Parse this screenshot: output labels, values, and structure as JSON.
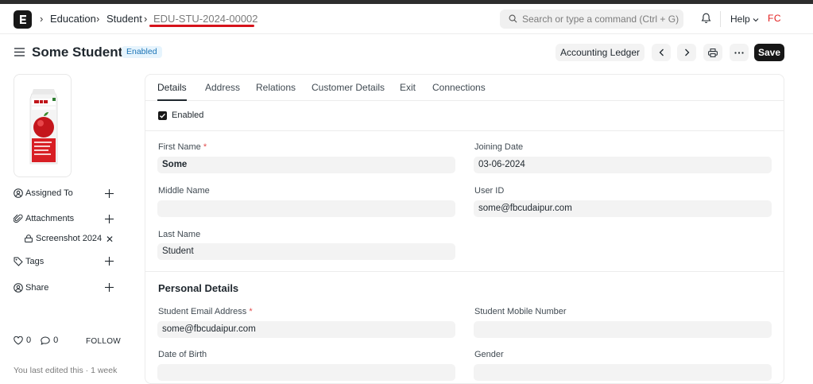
{
  "navbar": {
    "breadcrumbs": [
      "Education",
      "Student",
      "EDU-STU-2024-00002"
    ],
    "search_placeholder": "Search or type a command (Ctrl + G)",
    "help_label": "Help",
    "avatar_initials": "FC",
    "colors": {
      "avatar_text": "#e21d1d",
      "highlight_underline": "#d6131b"
    }
  },
  "page": {
    "title": "Some Student",
    "status_badge": "Enabled",
    "actions": {
      "ledger": "Accounting Ledger",
      "save": "Save"
    }
  },
  "sidebar": {
    "assigned_to": "Assigned To",
    "attachments": "Attachments",
    "attachment_file": "Screenshot 2024",
    "tags": "Tags",
    "share": "Share",
    "likes_count": "0",
    "comments_count": "0",
    "follow": "FOLLOW",
    "last_edited": "You last edited this · 1 week"
  },
  "form": {
    "tabs": [
      "Details",
      "Address",
      "Relations",
      "Customer Details",
      "Exit",
      "Connections"
    ],
    "active_tab": "Details",
    "enabled_checkbox": {
      "label": "Enabled",
      "checked": true
    },
    "fields": {
      "first_name": {
        "label": "First Name",
        "value": "Some",
        "required": true
      },
      "middle_name": {
        "label": "Middle Name",
        "value": ""
      },
      "last_name": {
        "label": "Last Name",
        "value": "Student"
      },
      "joining_date": {
        "label": "Joining Date",
        "value": "03-06-2024"
      },
      "user_id": {
        "label": "User ID",
        "value": "some@fbcudaipur.com"
      }
    },
    "personal_details": {
      "title": "Personal Details",
      "student_email": {
        "label": "Student Email Address",
        "value": "some@fbcudaipur.com",
        "required": true
      },
      "student_mobile": {
        "label": "Student Mobile Number",
        "value": ""
      },
      "date_of_birth": {
        "label": "Date of Birth",
        "value": ""
      },
      "gender": {
        "label": "Gender",
        "value": ""
      }
    }
  }
}
